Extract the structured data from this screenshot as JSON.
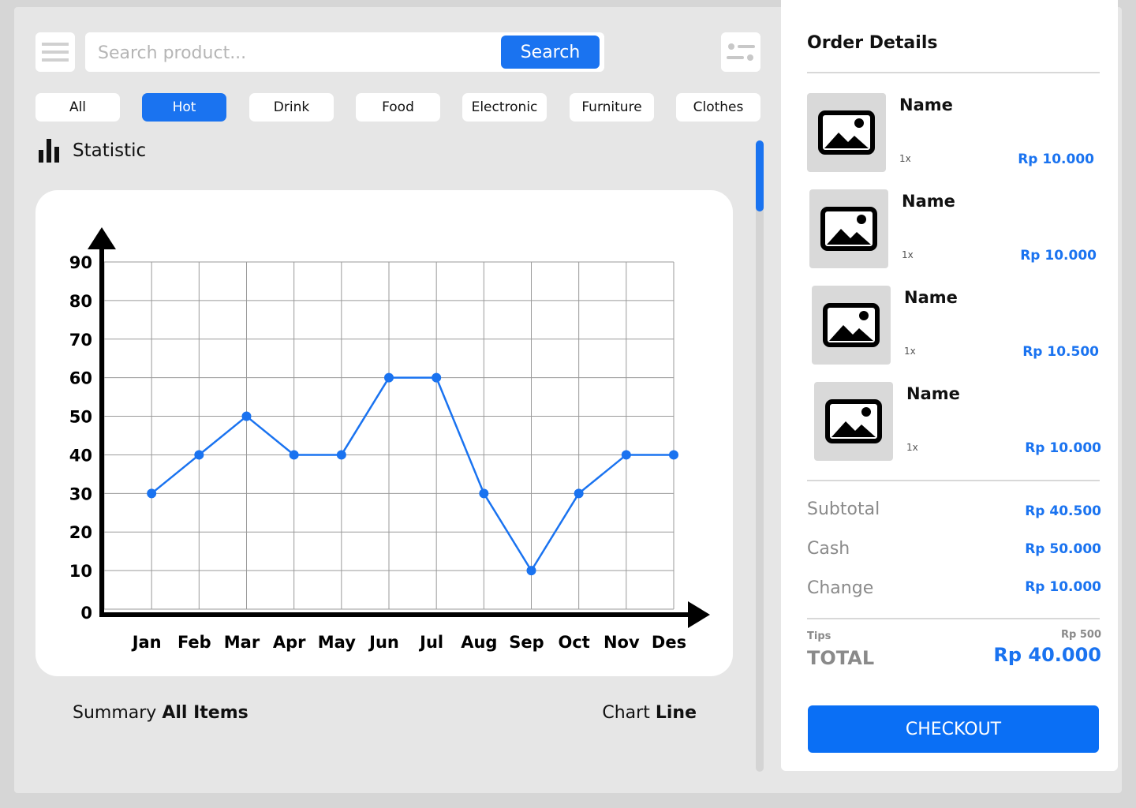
{
  "search": {
    "placeholder": "Search product...",
    "button_label": "Search"
  },
  "categories": [
    "All",
    "Hot",
    "Drink",
    "Food",
    "Electronic",
    "Furniture",
    "Clothes"
  ],
  "active_category": "Hot",
  "statistic": {
    "title": "Statistic"
  },
  "chart_data": {
    "type": "line",
    "categories": [
      "Jan",
      "Feb",
      "Mar",
      "Apr",
      "May",
      "Jun",
      "Jul",
      "Aug",
      "Sep",
      "Oct",
      "Nov",
      "Des"
    ],
    "series": [
      {
        "values": [
          30,
          40,
          50,
          40,
          40,
          60,
          60,
          30,
          10,
          30,
          40,
          40
        ]
      }
    ],
    "yticks": [
      0,
      10,
      20,
      30,
      40,
      50,
      60,
      70,
      80,
      90
    ],
    "ylim": [
      0,
      90
    ],
    "grid": true,
    "color": "#1a73f0"
  },
  "footer": {
    "summary_label": "Summary",
    "summary_value": "All Items",
    "chart_label": "Chart",
    "chart_value": "Line"
  },
  "order": {
    "title": "Order Details",
    "items": [
      {
        "name": "Name",
        "qty": "1x",
        "price": "Rp 10.000"
      },
      {
        "name": "Name",
        "qty": "1x",
        "price": "Rp 10.000"
      },
      {
        "name": "Name",
        "qty": "1x",
        "price": "Rp 10.500"
      },
      {
        "name": "Name",
        "qty": "1x",
        "price": "Rp 10.000"
      }
    ],
    "subtotal_label": "Subtotal",
    "subtotal_value": "Rp 40.500",
    "cash_label": "Cash",
    "cash_value": "Rp 50.000",
    "change_label": "Change",
    "change_value": "Rp 10.000",
    "tips_label": "Tips",
    "tips_value": "Rp 500",
    "total_label": "TOTAL",
    "total_value": "Rp 40.000",
    "checkout_label": "CHECKOUT"
  },
  "colors": {
    "accent": "#1a73f0",
    "panel_bg": "#e6e6e6",
    "muted": "#8a8a8a"
  },
  "icons": {
    "menu": "menu-icon",
    "filter": "filter-icon",
    "statistic": "bar-chart-icon",
    "thumbnail": "image-placeholder-icon"
  }
}
